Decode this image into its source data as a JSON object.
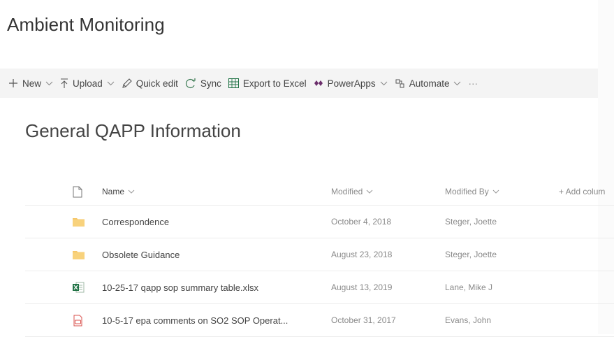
{
  "site": {
    "title": "Ambient Monitoring"
  },
  "commandbar": {
    "new": "New",
    "upload": "Upload",
    "quick_edit": "Quick edit",
    "sync": "Sync",
    "export": "Export to Excel",
    "powerapps": "PowerApps",
    "automate": "Automate",
    "more": "···"
  },
  "library": {
    "title": "General QAPP Information"
  },
  "columns": {
    "name": "Name",
    "modified": "Modified",
    "modified_by": "Modified By",
    "add_column": "+ Add colum"
  },
  "rows": [
    {
      "type": "folder",
      "name": "Correspondence",
      "modified": "October 4, 2018",
      "modified_by": "Steger, Joette"
    },
    {
      "type": "folder",
      "name": "Obsolete Guidance",
      "modified": "August 23, 2018",
      "modified_by": "Steger, Joette"
    },
    {
      "type": "excel",
      "name": "10-25-17 qapp sop summary table.xlsx",
      "modified": "August 13, 2019",
      "modified_by": "Lane, Mike J"
    },
    {
      "type": "pdf",
      "name": "10-5-17 epa comments on SO2 SOP Operat...",
      "modified": "October 31, 2017",
      "modified_by": "Evans, John"
    }
  ],
  "colors": {
    "folder": "#f6c76b",
    "excel": "#217346",
    "pdf": "#d9534f",
    "commandbar_bg": "#f4f4f4"
  }
}
